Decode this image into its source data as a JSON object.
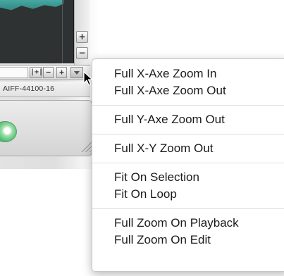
{
  "app": {
    "status": {
      "format_label": "AIFF-44100-16"
    },
    "vertical_zoom": {
      "zoom_in_label": "+",
      "zoom_out_label": "−"
    },
    "horizontal_zoom": {
      "fit_label": "|+|",
      "zoom_out_label": "−",
      "zoom_in_label": "+"
    }
  },
  "menu": {
    "groups": [
      {
        "items": [
          "Full X-Axe Zoom In",
          "Full X-Axe Zoom Out"
        ]
      },
      {
        "items": [
          "Full Y-Axe Zoom Out"
        ]
      },
      {
        "items": [
          "Full X-Y Zoom Out"
        ]
      },
      {
        "items": [
          "Fit On Selection",
          "Fit On Loop"
        ]
      },
      {
        "items": [
          "Full Zoom On Playback",
          "Full Zoom On Edit"
        ]
      }
    ]
  },
  "colors": {
    "waveform_bg": "#2f3233",
    "waveform_fill": "#47a8a1",
    "play_button": "#4cbc6c"
  },
  "icons": {
    "cursor": "arrow-pointer-icon",
    "zoom_menu": "triangle-down-icon",
    "resize": "resize-grip-icon",
    "play": "play-knob-icon"
  }
}
